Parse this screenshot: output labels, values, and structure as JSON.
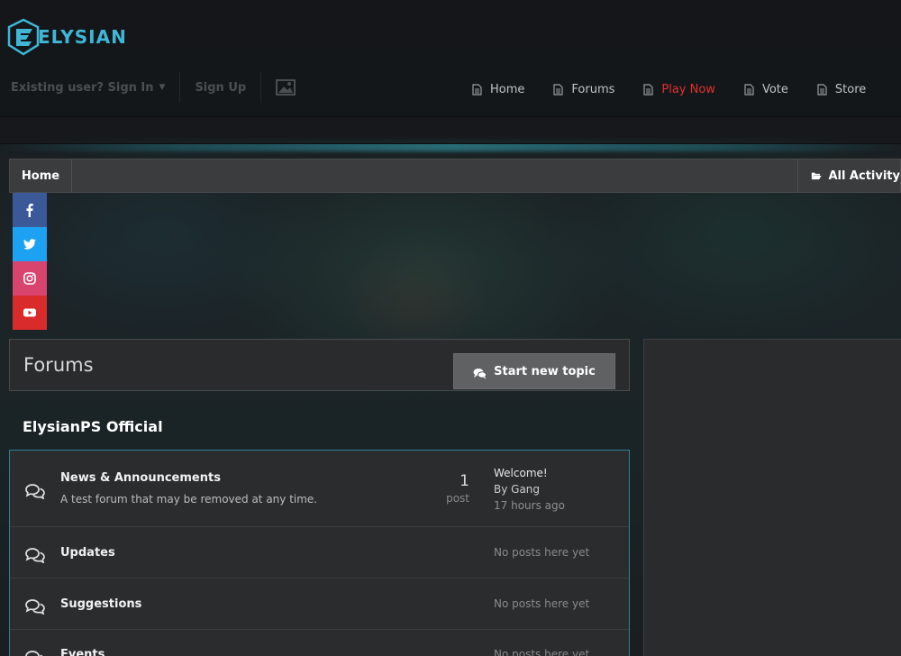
{
  "brand": {
    "logo_text": "ELYSIAN",
    "accent": "#3fb6d6"
  },
  "userbar": {
    "signin_label": "Existing user? Sign In",
    "signup_label": "Sign Up"
  },
  "nav": {
    "items": [
      {
        "label": "Home",
        "active": false
      },
      {
        "label": "Forums",
        "active": false
      },
      {
        "label": "Play Now",
        "active": true
      },
      {
        "label": "Vote",
        "active": false
      },
      {
        "label": "Store",
        "active": false
      }
    ],
    "active_color": "#e03030"
  },
  "breadcrumb": {
    "home": "Home",
    "all_activity": "All Activity"
  },
  "social": [
    {
      "name": "facebook",
      "color": "#3b5998"
    },
    {
      "name": "twitter",
      "color": "#1da1f2"
    },
    {
      "name": "instagram",
      "color": "#e1306c"
    },
    {
      "name": "youtube",
      "color": "#d92b2b"
    }
  ],
  "forums": {
    "title": "Forums",
    "start_topic_label": "Start new topic",
    "category": "ElysianPS Official",
    "list": [
      {
        "name": "News & Announcements",
        "description": "A test forum that may be removed at any time.",
        "post_count": "1",
        "post_label": "post",
        "last_title": "Welcome!",
        "last_by": "By Gang",
        "last_time": "17 hours ago"
      },
      {
        "name": "Updates",
        "empty_text": "No posts here yet"
      },
      {
        "name": "Suggestions",
        "empty_text": "No posts here yet"
      },
      {
        "name": "Events",
        "empty_text": "No posts here yet"
      }
    ]
  }
}
